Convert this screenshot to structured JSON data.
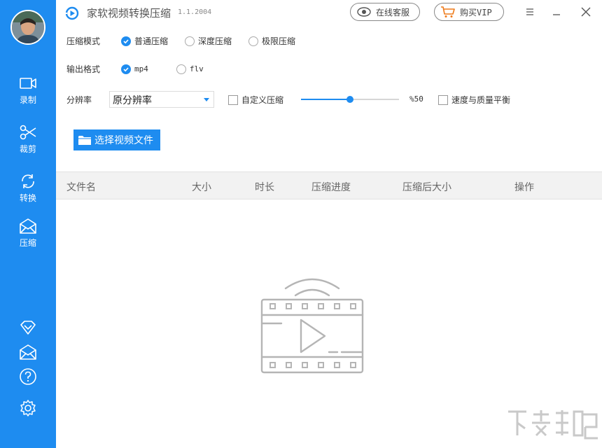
{
  "sidebar": {
    "nav": [
      {
        "label": "录制",
        "icon": "record-icon"
      },
      {
        "label": "裁剪",
        "icon": "scissors-icon"
      },
      {
        "label": "转换",
        "icon": "convert-icon"
      },
      {
        "label": "压缩",
        "icon": "compress-icon"
      }
    ],
    "active_index": 3,
    "bottom_icons": [
      "diamond-icon",
      "mail-icon",
      "help-icon",
      "settings-icon"
    ]
  },
  "titlebar": {
    "title": "家软视频转换压缩",
    "version": "1.1.2004",
    "support_label": "在线客服",
    "vip_label": "购买VIP"
  },
  "options": {
    "mode_label": "压缩模式",
    "modes": [
      {
        "label": "普通压缩",
        "checked": true
      },
      {
        "label": "深度压缩",
        "checked": false
      },
      {
        "label": "极限压缩",
        "checked": false
      }
    ],
    "format_label": "输出格式",
    "formats": [
      {
        "label": "mp4",
        "checked": true
      },
      {
        "label": "flv",
        "checked": false
      }
    ],
    "resolution_label": "分辨率",
    "resolution_value": "原分辨率",
    "custom_compress_label": "自定义压缩",
    "custom_compress_checked": false,
    "quality_percent": 50,
    "quality_text": "%50",
    "balance_label": "速度与质量平衡",
    "balance_checked": false
  },
  "choose_button_label": "选择视频文件",
  "table": {
    "columns": [
      "文件名",
      "大小",
      "时长",
      "压缩进度",
      "压缩后大小",
      "操作"
    ],
    "rows": []
  },
  "colors": {
    "accent": "#1e8cf0",
    "sidebar": "#1e8cf0",
    "header_bg": "#f2f2f2"
  }
}
